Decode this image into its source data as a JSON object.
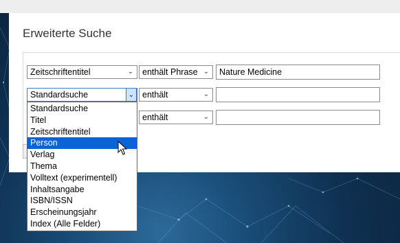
{
  "title": "Erweiterte Suche",
  "rows": [
    {
      "field": "Zeitschriftentitel",
      "operator": "enthält Phrase",
      "value": "Nature Medicine"
    },
    {
      "field": "Standardsuche",
      "operator": "enthält",
      "value": ""
    },
    {
      "field": "",
      "operator": "enthält",
      "value": ""
    }
  ],
  "dropdown": {
    "options": [
      "Standardsuche",
      "Titel",
      "Zeitschriftentitel",
      "Person",
      "Verlag",
      "Thema",
      "Volltext (experimentell)",
      "Inhaltsangabe",
      "ISBN/ISSN",
      "Erscheinungsjahr",
      "Index (Alle Felder)"
    ],
    "highlighted": "Person"
  },
  "icons": {
    "select_arrow": "chevron-down-icon",
    "cursor": "mouse-pointer-icon"
  },
  "colors": {
    "highlight": "#0a64d6",
    "open_border": "#3b7cc9"
  }
}
